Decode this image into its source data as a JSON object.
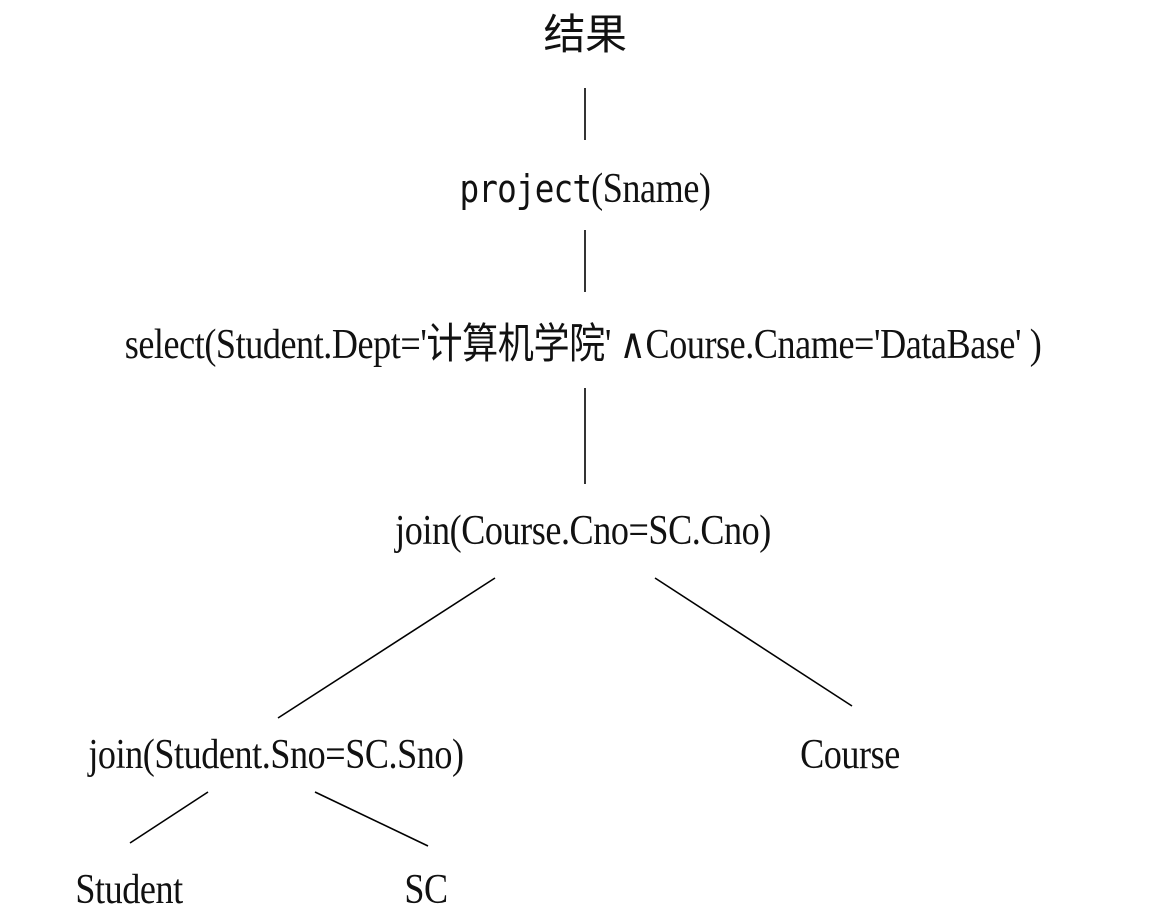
{
  "tree": {
    "root": {
      "label": "结果"
    },
    "project": {
      "keyword": "project",
      "args": "(Sname)"
    },
    "select": {
      "label": "select(Student.Dept='计算机学院' ∧Course.Cname='DataBase' )"
    },
    "join_top": {
      "label": "join(Course.Cno=SC.Cno)"
    },
    "join_left": {
      "label": "join(Student.Sno=SC.Sno)"
    },
    "leaf_course": {
      "label": "Course"
    },
    "leaf_student": {
      "label": "Student"
    },
    "leaf_sc": {
      "label": "SC"
    }
  }
}
